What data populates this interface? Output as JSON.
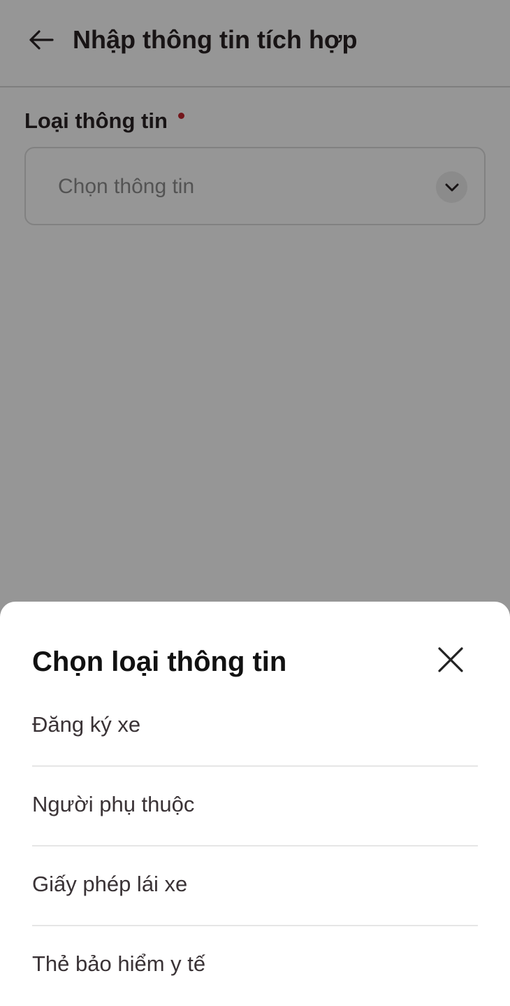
{
  "header": {
    "title": "Nhập thông tin tích hợp",
    "back_icon": "arrow-left-icon"
  },
  "form": {
    "field_label": "Loại thông tin",
    "required": true,
    "select_placeholder": "Chọn thông tin",
    "chevron_icon": "chevron-down-icon"
  },
  "sheet": {
    "title": "Chọn loại thông tin",
    "close_icon": "close-icon",
    "options": [
      {
        "label": "Đăng ký xe"
      },
      {
        "label": "Người phụ thuộc"
      },
      {
        "label": "Giấy phép lái xe"
      },
      {
        "label": "Thẻ bảo hiểm y tế"
      }
    ]
  },
  "colors": {
    "required_dot": "#c4262e",
    "overlay": "rgba(0,0,0,0.41)",
    "title_text": "#2a2224"
  }
}
